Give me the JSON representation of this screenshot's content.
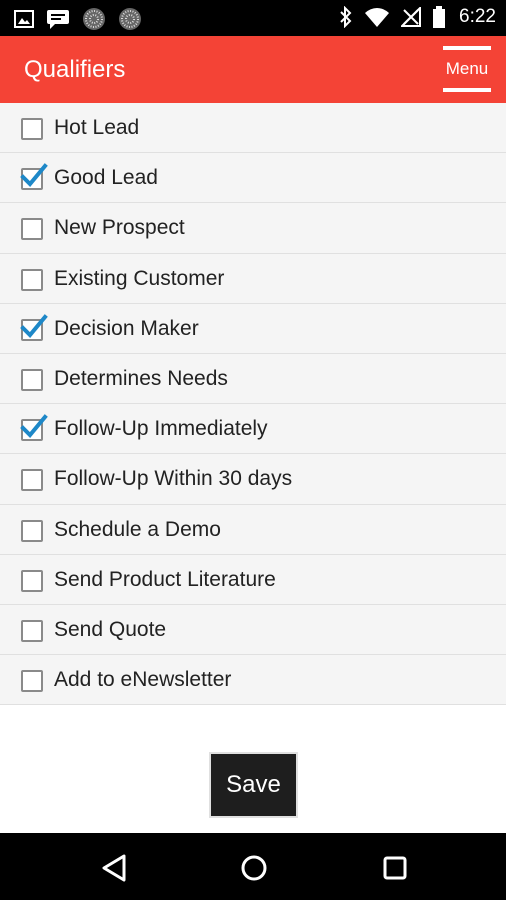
{
  "status_bar": {
    "time": "6:22",
    "left_icons": [
      "image-icon",
      "chat-icon",
      "dotted-globe-icon",
      "dotted-globe-icon"
    ],
    "right_icons": [
      "bluetooth-icon",
      "wifi-icon",
      "no-signal-icon",
      "battery-icon"
    ]
  },
  "app_bar": {
    "title": "Qualifiers",
    "menu_label": "Menu",
    "color": "#f44336"
  },
  "qualifiers": [
    {
      "label": "Hot Lead",
      "checked": false
    },
    {
      "label": "Good Lead",
      "checked": true
    },
    {
      "label": "New Prospect",
      "checked": false
    },
    {
      "label": "Existing Customer",
      "checked": false
    },
    {
      "label": "Decision Maker",
      "checked": true
    },
    {
      "label": "Determines Needs",
      "checked": false
    },
    {
      "label": "Follow-Up Immediately",
      "checked": true
    },
    {
      "label": "Follow-Up Within 30 days",
      "checked": false
    },
    {
      "label": "Schedule a Demo",
      "checked": false
    },
    {
      "label": "Send Product Literature",
      "checked": false
    },
    {
      "label": "Send Quote",
      "checked": false
    },
    {
      "label": "Add to eNewsletter",
      "checked": false
    }
  ],
  "actions": {
    "save_label": "Save"
  },
  "nav_bar": {
    "buttons": [
      "back-icon",
      "home-icon",
      "recents-icon"
    ]
  },
  "colors": {
    "accent_check": "#1e88c8",
    "save_bg": "#1e1e1e"
  }
}
